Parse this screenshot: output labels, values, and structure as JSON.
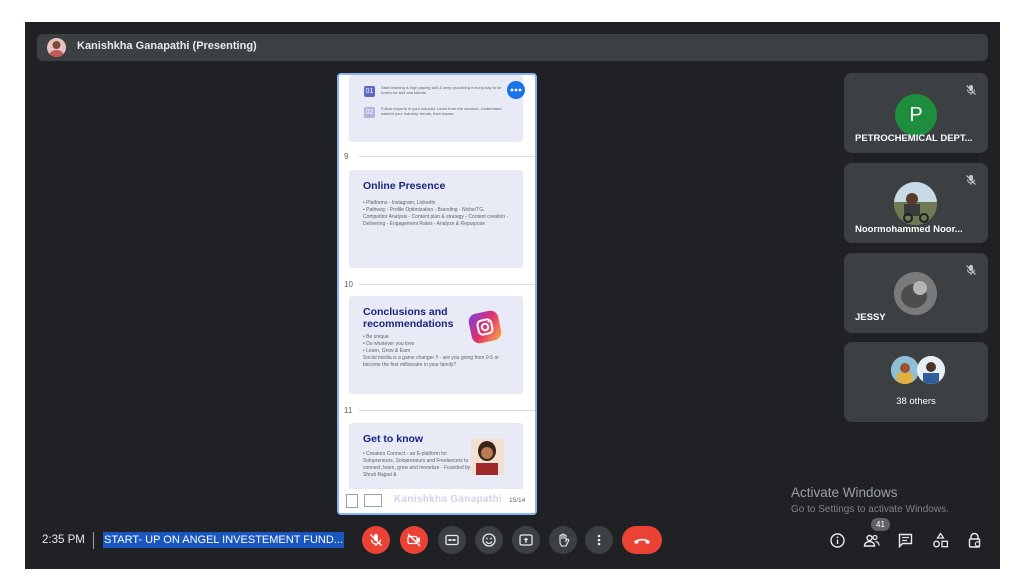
{
  "presenter": {
    "name": "Kanishkha Ganapathi (Presenting)"
  },
  "slides": {
    "card1": {
      "items": [
        {
          "num": "01",
          "text": "Start learning is high paying skill & keep practicing it every day to for lovers for skill and talents."
        },
        {
          "num": "02",
          "text": "Follow experts in your industry. Learn from the creators. Understand wanted your industry, trends, their issues."
        }
      ]
    },
    "slide9": {
      "num": "9",
      "title": "Online Presence",
      "text": "• Platforms - Instagram, Linkedin\n• Pathway - Profile Optimization - Branding - Niche/TG, Competitor Analysis - Content plan & strategy - Content creation - Delivering - Engagement Rates - Analyze & Repurpose"
    },
    "slide10": {
      "num": "10",
      "title": "Conclusions and recommendations",
      "text": "• Be unique\n• Do whatever you love\n• Learn, Grow & Earn\nSocial media is a game changer !! - are you going from 0-5 or become the first millionaire in your family?"
    },
    "slide11": {
      "num": "11",
      "title": "Get to know",
      "text": "• Creators Connect - an E-platform for Solopreneurs, Solopreneurs and Freelancers to connect, learn, grow and monetize - Founded by Shruti Rajput &"
    },
    "footer": {
      "name": "Kanishkha Ganapathi",
      "page": "15/14"
    }
  },
  "participants": [
    {
      "name": "PETROCHEMICAL DEPT...",
      "initial": "P",
      "color": "#1e8e3e",
      "muted": true
    },
    {
      "name": "Noormohammed Noor...",
      "muted": true
    },
    {
      "name": "JESSY",
      "muted": true
    },
    {
      "name": "38 others"
    }
  ],
  "watermark": {
    "title": "Activate Windows",
    "subtitle": "Go to Settings to activate Windows."
  },
  "bottom": {
    "time": "2:35 PM",
    "meeting": "START- UP ON ANGEL INVESTEMENT FUND...",
    "participant_count": "41"
  }
}
